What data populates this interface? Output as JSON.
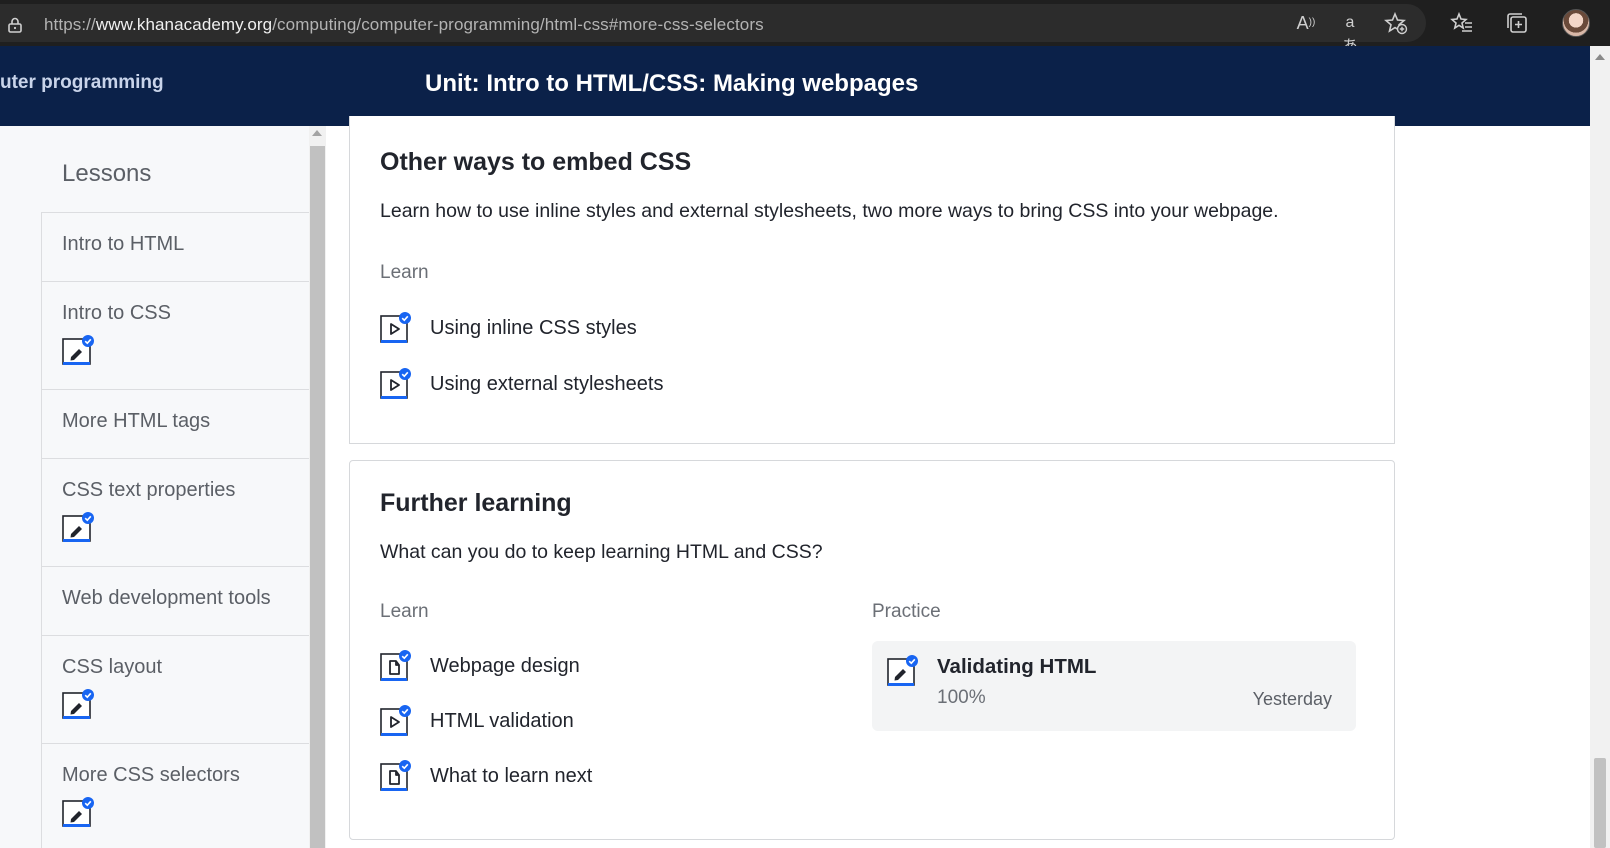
{
  "browser": {
    "url_prefix": "https://",
    "url_host": "www.khanacademy.org",
    "url_path": "/computing/computer-programming/html-css#more-css-selectors",
    "toolbar_icons": [
      "read-aloud-icon",
      "translate-icon",
      "add-favorite-icon",
      "favorites-icon",
      "collections-icon",
      "profile-avatar"
    ]
  },
  "header": {
    "course_crumb": "uter programming",
    "unit_title": "Unit: Intro to HTML/CSS: Making webpages"
  },
  "sidebar": {
    "heading": "Lessons",
    "items": [
      {
        "label": "Intro to HTML",
        "badge": false
      },
      {
        "label": "Intro to CSS",
        "badge": true
      },
      {
        "label": "More HTML tags",
        "badge": false
      },
      {
        "label": "CSS text properties",
        "badge": true
      },
      {
        "label": "Web development tools",
        "badge": false
      },
      {
        "label": "CSS layout",
        "badge": true
      },
      {
        "label": "More CSS selectors",
        "badge": true
      }
    ]
  },
  "embed_section": {
    "title": "Other ways to embed CSS",
    "description": "Learn how to use inline styles and external stylesheets, two more ways to bring CSS into your webpage.",
    "learn_label": "Learn",
    "items": [
      {
        "label": "Using inline CSS styles",
        "icon": "video-icon"
      },
      {
        "label": "Using external stylesheets",
        "icon": "video-icon"
      }
    ]
  },
  "further_section": {
    "title": "Further learning",
    "description": "What can you do to keep learning HTML and CSS?",
    "learn_label": "Learn",
    "practice_label": "Practice",
    "items": [
      {
        "label": "Webpage design",
        "icon": "article-icon"
      },
      {
        "label": "HTML validation",
        "icon": "video-icon"
      },
      {
        "label": "What to learn next",
        "icon": "article-icon"
      }
    ],
    "practice": {
      "title": "Validating HTML",
      "score": "100%",
      "date": "Yesterday"
    }
  },
  "colors": {
    "header_bg": "#0b2149",
    "accent_blue": "#1865f2",
    "completed_check": "#1865f2"
  }
}
